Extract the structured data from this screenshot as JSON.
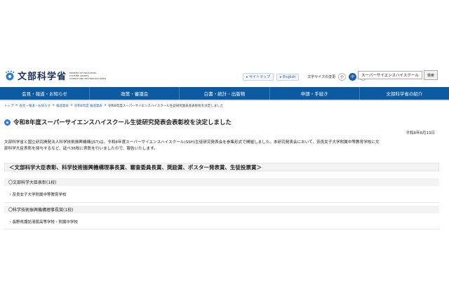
{
  "header": {
    "logo_text": "文部科学省",
    "logo_sub": [
      "MINISTRY OF EDUCATION,",
      "CULTURE, SPORTS,",
      "SCIENCE AND TECHNOLOGY-JAPAN"
    ],
    "util_links": [
      "サイトマップ",
      "English"
    ],
    "font_size_label": "文字サイズの変更",
    "font_size_options": [
      "小",
      "中",
      "大"
    ],
    "search_value": "スーパーサイエンスハイスクール",
    "search_button": "検索"
  },
  "nav": {
    "items": [
      "会見・報道・お知らせ",
      "政策・審議会",
      "白書・統計・出版物",
      "申請・手続き",
      "文部科学省の紹介"
    ]
  },
  "breadcrumb": {
    "items": [
      "トップ",
      "会見・報道・お知らせ",
      "報道発表",
      "令和8年度 報道発表"
    ],
    "current": "令和8年度スーパーサイエンスハイスクール生徒研究発表会表彰校を決定しました",
    "separator": ">"
  },
  "article": {
    "title": "令和8年度スーパーサイエンスハイスクール生徒研究発表会表彰校を決定しました",
    "date": "令和8年8月13日",
    "body_line1": "文部科学省と国立研究開発法人科学技術振興機構(JST)は、令和8年度スーパーサイエンスハイスクール(SSH)生徒研究発表会を参集形式で開催しました。本研究発表会において、奈良女子大学附属中等教育学校に文",
    "body_line2": "部科学大臣表彰を授与するなど、延べ36校に表彰を行いましたので、報告いたします。",
    "highlight": "＜文部科学大臣表彰、科学技術振興機構理事長賞、審査委員長賞、奨励賞、ポスター発表賞、生徒投票賞＞",
    "sections": [
      {
        "heading": "〇文部科学大臣表彰(1校)",
        "items": [
          "・奈良女子大学附属中等教育学校"
        ]
      },
      {
        "heading": "〇科学技術振興機構理事長賞(1校)",
        "items": [
          "・長野県諏訪清陵高等学校・附属中学校"
        ]
      }
    ]
  },
  "colors": {
    "nav": "#0b5aa2",
    "accent": "#2d7ed1",
    "logo": "#1b2f5a"
  }
}
